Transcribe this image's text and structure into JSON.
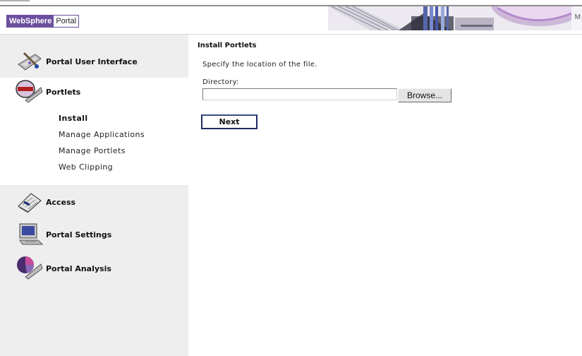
{
  "header": {
    "logo_brand": "WebSphere",
    "logo_product": "Portal",
    "banner_text": "M"
  },
  "sidebar": {
    "items": [
      {
        "label": "Portal User Interface",
        "icon": "palette-brush-icon"
      },
      {
        "label": "Portlets",
        "icon": "portlets-icon"
      },
      {
        "label": "Access",
        "icon": "notebook-icon"
      },
      {
        "label": "Portal Settings",
        "icon": "computer-icon"
      },
      {
        "label": "Portal Analysis",
        "icon": "pie-chart-icon"
      }
    ],
    "portlets_submenu": [
      "Install",
      "Manage Applications",
      "Manage Portlets",
      "Web Clipping"
    ],
    "active_submenu": "Install"
  },
  "main": {
    "title": "Install Portlets",
    "description": "Specify the location of the file.",
    "directory_label": "Directory:",
    "directory_value": "",
    "browse_label": "Browse...",
    "next_label": "Next"
  },
  "colors": {
    "brand_purple": "#6c4fa0",
    "sidebar_bg": "#eeeeee",
    "next_border": "#1f2a60"
  }
}
